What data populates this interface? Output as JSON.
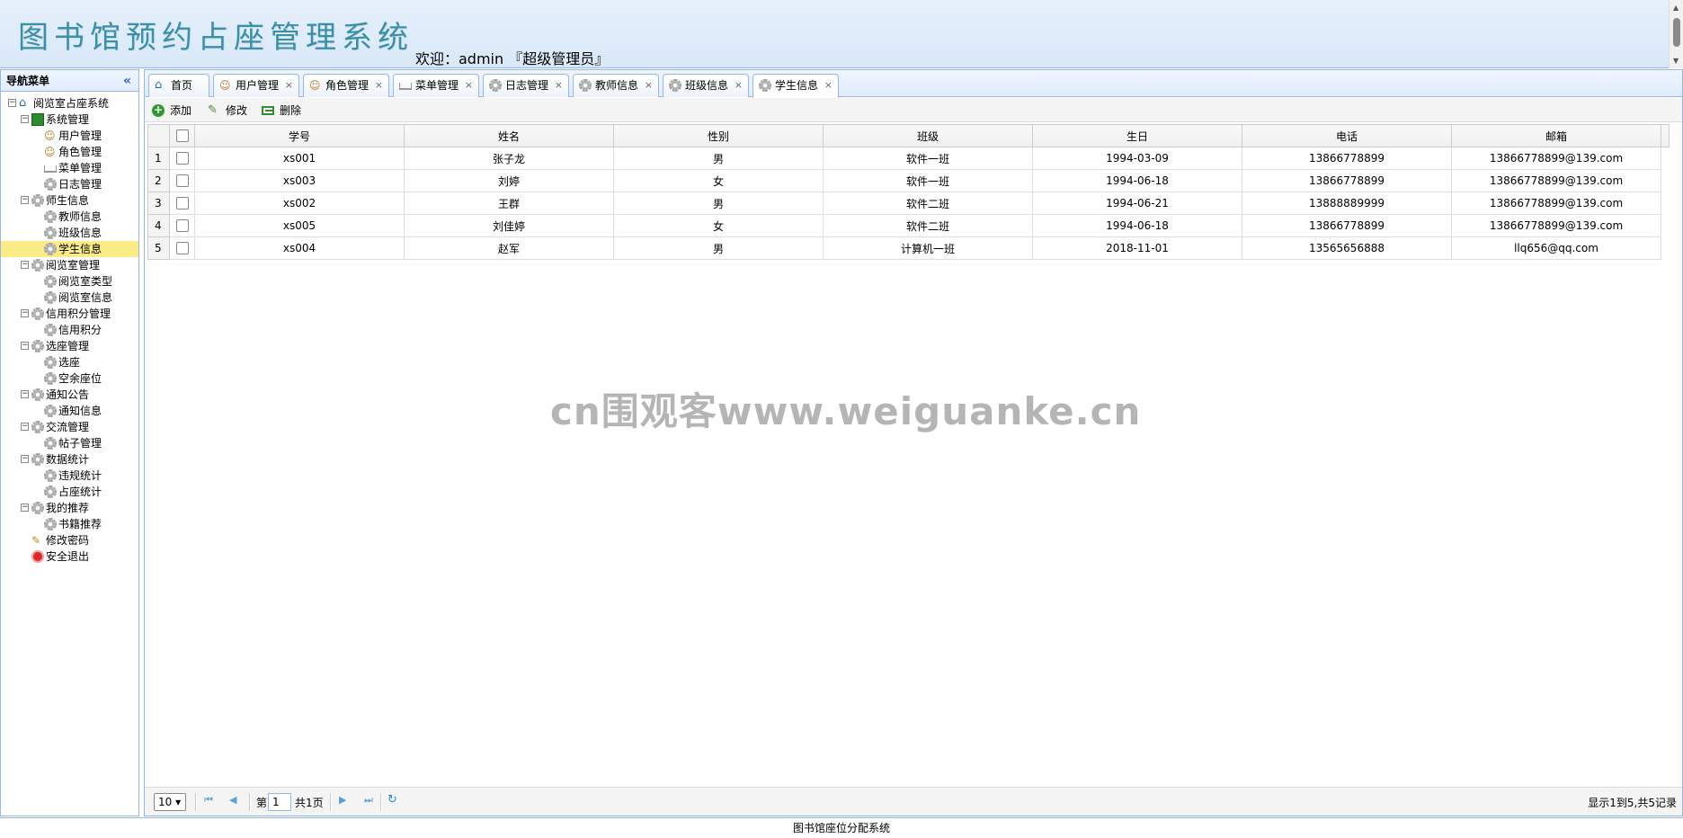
{
  "header": {
    "app_title": "图书馆预约占座管理系统",
    "welcome": "欢迎：admin 『超级管理员』"
  },
  "sidebar": {
    "title": "导航菜单",
    "collapse_icon": "double-chevron-left-icon",
    "tree": [
      {
        "label": "阅览室占座系统",
        "icon": "home-icon"
      },
      {
        "label": "系统管理",
        "icon": "folder-green-icon"
      },
      {
        "label": "用户管理",
        "icon": "user-icon"
      },
      {
        "label": "角色管理",
        "icon": "user-icon"
      },
      {
        "label": "菜单管理",
        "icon": "sitemap-icon"
      },
      {
        "label": "日志管理",
        "icon": "gear-icon"
      },
      {
        "label": "师生信息",
        "icon": "gear-icon"
      },
      {
        "label": "教师信息",
        "icon": "gear-icon"
      },
      {
        "label": "班级信息",
        "icon": "gear-icon"
      },
      {
        "label": "学生信息",
        "icon": "gear-icon",
        "selected": true
      },
      {
        "label": "阅览室管理",
        "icon": "gear-icon"
      },
      {
        "label": "阅览室类型",
        "icon": "gear-icon"
      },
      {
        "label": "阅览室信息",
        "icon": "gear-icon"
      },
      {
        "label": "信用积分管理",
        "icon": "gear-icon"
      },
      {
        "label": "信用积分",
        "icon": "gear-icon"
      },
      {
        "label": "选座管理",
        "icon": "gear-icon"
      },
      {
        "label": "选座",
        "icon": "gear-icon"
      },
      {
        "label": "空余座位",
        "icon": "gear-icon"
      },
      {
        "label": "通知公告",
        "icon": "gear-icon"
      },
      {
        "label": "通知信息",
        "icon": "gear-icon"
      },
      {
        "label": "交流管理",
        "icon": "gear-icon"
      },
      {
        "label": "帖子管理",
        "icon": "gear-icon"
      },
      {
        "label": "数据统计",
        "icon": "gear-icon"
      },
      {
        "label": "违规统计",
        "icon": "gear-icon"
      },
      {
        "label": "占座统计",
        "icon": "gear-icon"
      },
      {
        "label": "我的推荐",
        "icon": "gear-icon"
      },
      {
        "label": "书籍推荐",
        "icon": "gear-icon"
      },
      {
        "label": "修改密码",
        "icon": "key-icon"
      },
      {
        "label": "安全退出",
        "icon": "exit-icon"
      }
    ]
  },
  "tabs": [
    {
      "label": "首页",
      "icon": "home-icon",
      "closable": false
    },
    {
      "label": "用户管理",
      "icon": "user-icon",
      "closable": true
    },
    {
      "label": "角色管理",
      "icon": "user-icon",
      "closable": true
    },
    {
      "label": "菜单管理",
      "icon": "sitemap-icon",
      "closable": true
    },
    {
      "label": "日志管理",
      "icon": "gear-icon",
      "closable": true
    },
    {
      "label": "教师信息",
      "icon": "gear-icon",
      "closable": true
    },
    {
      "label": "班级信息",
      "icon": "gear-icon",
      "closable": true
    },
    {
      "label": "学生信息",
      "icon": "gear-icon",
      "closable": true,
      "active": true
    }
  ],
  "toolbar": {
    "add": "添加",
    "edit": "修改",
    "delete": "删除"
  },
  "grid": {
    "columns": [
      "学号",
      "姓名",
      "性别",
      "班级",
      "生日",
      "电话",
      "邮箱"
    ],
    "rows": [
      [
        "1",
        "xs001",
        "张子龙",
        "男",
        "软件一班",
        "1994-03-09",
        "13866778899",
        "13866778899@139.com"
      ],
      [
        "2",
        "xs003",
        "刘婷",
        "女",
        "软件一班",
        "1994-06-18",
        "13866778899",
        "13866778899@139.com"
      ],
      [
        "3",
        "xs002",
        "王群",
        "男",
        "软件二班",
        "1994-06-21",
        "13888889999",
        "13866778899@139.com"
      ],
      [
        "4",
        "xs005",
        "刘佳婷",
        "女",
        "软件二班",
        "1994-06-18",
        "13866778899",
        "13866778899@139.com"
      ],
      [
        "5",
        "xs004",
        "赵军",
        "男",
        "计算机一班",
        "2018-11-01",
        "13565656888",
        "llq656@qq.com"
      ]
    ]
  },
  "pager": {
    "page_size": "10",
    "page_prefix": "第",
    "page_value": "1",
    "page_suffix": "共1页",
    "info": "显示1到5,共5记录"
  },
  "footer": "图书馆座位分配系统",
  "watermark": "cn围观客www.weiguanke.cn",
  "colors": {
    "border": "#95b8e7",
    "header_bg": "#e0ecff",
    "selected": "#fbec88",
    "title": "#3b8fa8"
  }
}
